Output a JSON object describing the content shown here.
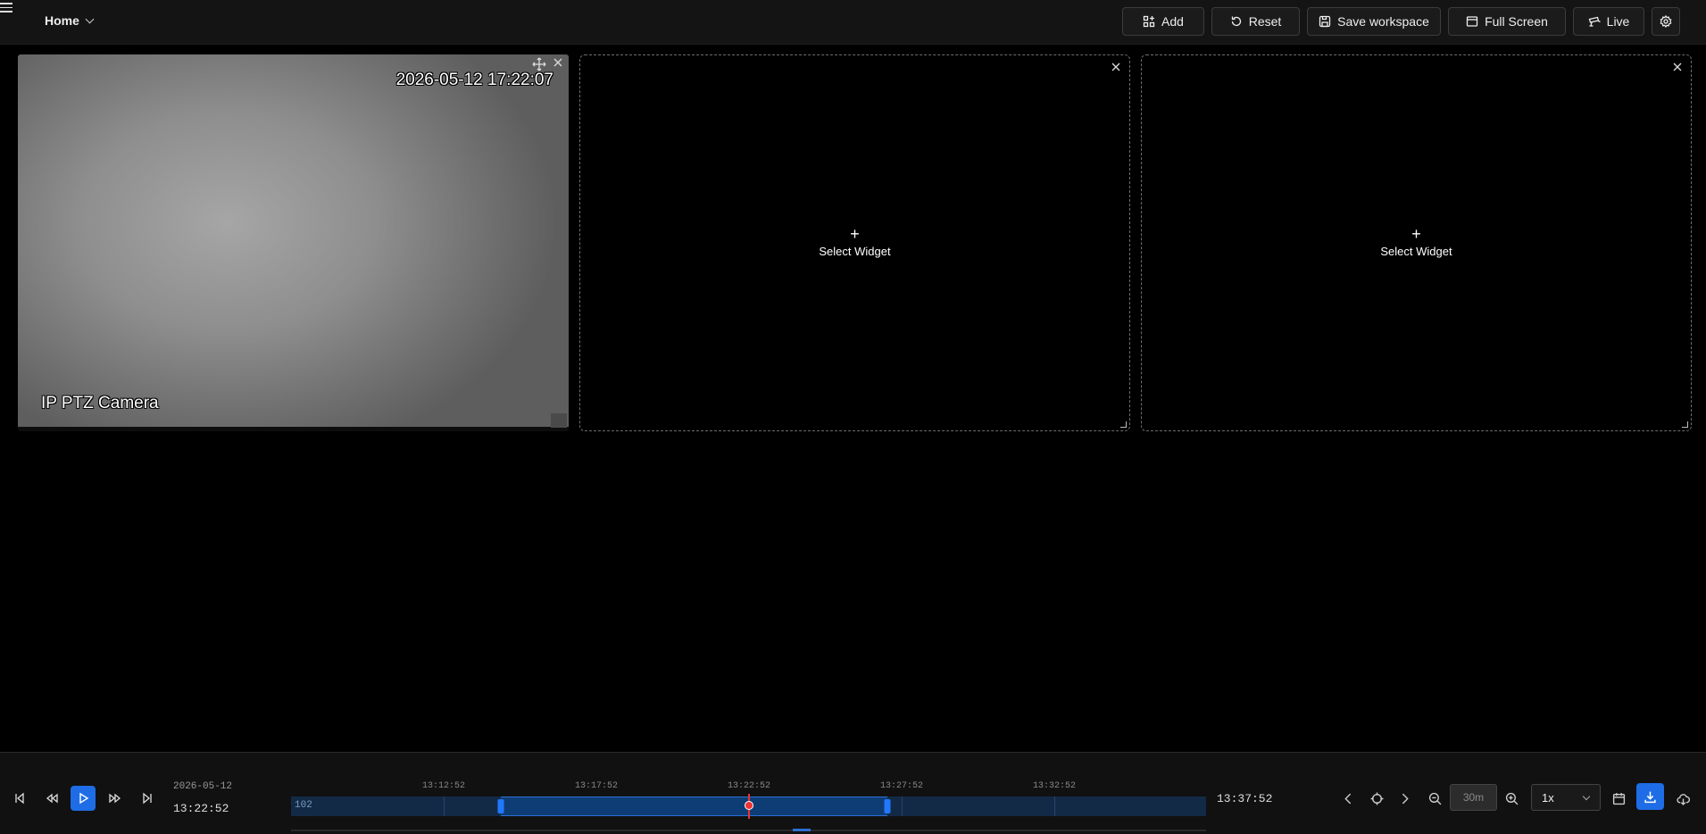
{
  "header": {
    "workspace_label": "Home",
    "buttons": {
      "add": "Add",
      "reset": "Reset",
      "save": "Save workspace",
      "fullscreen": "Full Screen",
      "live": "Live"
    }
  },
  "widgets": {
    "camera": {
      "timestamp": "2026-05-12 17:22:07",
      "name": "IP PTZ Camera"
    },
    "empty_1": {
      "label": "Select Widget",
      "plus": "+"
    },
    "empty_2": {
      "label": "Select Widget",
      "plus": "+"
    }
  },
  "playback": {
    "current_date": "2026-05-12",
    "current_time": "13:22:52",
    "end_time": "13:37:52",
    "timeline_labels": [
      "13:12:52",
      "13:17:52",
      "13:22:52",
      "13:27:52",
      "13:32:52"
    ],
    "track_name": "102",
    "zoom_value": "30m",
    "speed": "1x"
  },
  "colors": {
    "accent": "#1e6de6",
    "playhead": "#e33333",
    "track": "#132a46"
  },
  "icons": [
    "menu-icon",
    "chevron-down-icon",
    "add-grid-icon",
    "reset-icon",
    "save-icon",
    "fullscreen-icon",
    "live-icon",
    "settings-icon",
    "move-icon",
    "close-icon",
    "skip-back-icon",
    "rewind-icon",
    "play-icon",
    "fast-forward-icon",
    "skip-forward-icon",
    "chevron-left-icon",
    "crosshair-icon",
    "chevron-right-icon",
    "zoom-out-icon",
    "zoom-in-icon",
    "calendar-icon",
    "download-icon",
    "cloud-download-icon"
  ]
}
